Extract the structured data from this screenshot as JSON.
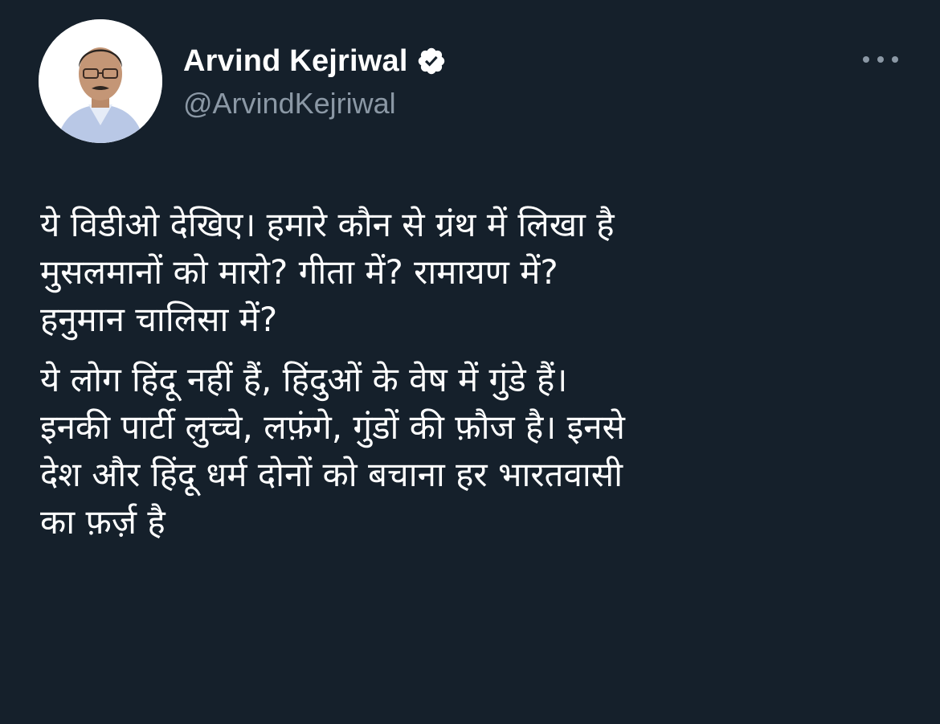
{
  "author": {
    "display_name": "Arvind Kejriwal",
    "handle": "@ArvindKejriwal",
    "verified": true,
    "avatar": "profile-photo"
  },
  "actions": {
    "more_icon": "more-horizontal-icon"
  },
  "tweet": {
    "paragraphs": [
      "ये विडीओ देखिए। हमारे कौन से ग्रंथ में लिखा है\nमुसलमानों को मारो? गीता में? रामायण में?\nहनुमान चालिसा में?",
      "ये लोग हिंदू नहीं हैं, हिंदुओं के वेष में गुंडे हैं।\nइनकी पार्टी लुच्चे, लफ़ंगे, गुंडों की फ़ौज है। इनसे\nदेश और हिंदू धर्म दोनों को बचाना हर भारतवासी\nका फ़र्ज़ है"
    ]
  },
  "colors": {
    "background": "#15202b",
    "text": "#ffffff",
    "secondary_text": "#8b98a5"
  }
}
